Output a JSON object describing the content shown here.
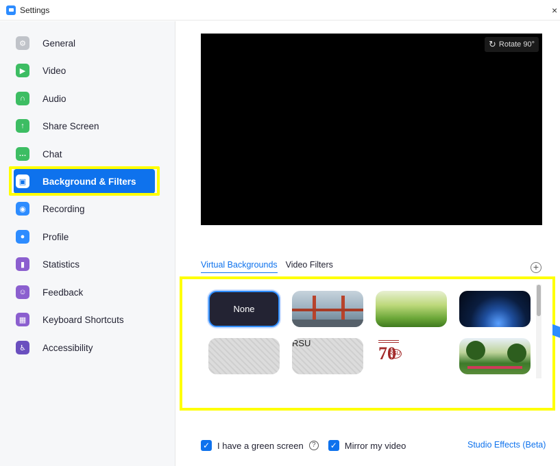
{
  "window": {
    "title": "Settings",
    "close_glyph": "×"
  },
  "sidebar": {
    "items": [
      {
        "label": "General",
        "icon": "gear-icon",
        "color": "#c0c3c9",
        "glyph": "⚙"
      },
      {
        "label": "Video",
        "icon": "video-icon",
        "color": "#3dbd63",
        "glyph": "▶"
      },
      {
        "label": "Audio",
        "icon": "headphones-icon",
        "color": "#3dbd63",
        "glyph": "∩"
      },
      {
        "label": "Share Screen",
        "icon": "share-screen-icon",
        "color": "#3dbd63",
        "glyph": "↑"
      },
      {
        "label": "Chat",
        "icon": "chat-icon",
        "color": "#3dbd63",
        "glyph": "…"
      },
      {
        "label": "Background & Filters",
        "icon": "background-icon",
        "color": "#0e72ed",
        "glyph": "▣",
        "active": true
      },
      {
        "label": "Recording",
        "icon": "recording-icon",
        "color": "#2d8cff",
        "glyph": "◉"
      },
      {
        "label": "Profile",
        "icon": "profile-icon",
        "color": "#2d8cff",
        "glyph": "●"
      },
      {
        "label": "Statistics",
        "icon": "statistics-icon",
        "color": "#8b5fcf",
        "glyph": "▮"
      },
      {
        "label": "Feedback",
        "icon": "feedback-icon",
        "color": "#8b5fcf",
        "glyph": "☺"
      },
      {
        "label": "Keyboard Shortcuts",
        "icon": "keyboard-icon",
        "color": "#8b5fcf",
        "glyph": "▦"
      },
      {
        "label": "Accessibility",
        "icon": "accessibility-icon",
        "color": "#6a4fbf",
        "glyph": "♿"
      }
    ]
  },
  "preview": {
    "rotate_label": "Rotate 90°",
    "rotate_glyph": "↻"
  },
  "tabs": [
    {
      "label": "Virtual Backgrounds",
      "active": true
    },
    {
      "label": "Video Filters",
      "active": false
    }
  ],
  "add_glyph": "+",
  "backgrounds": {
    "none_label": "None",
    "rsu_text": "RSU",
    "logo_number": "70",
    "logo_badge": "RSU"
  },
  "footer": {
    "green_screen_label": "I have a green screen",
    "green_screen_checked": true,
    "mirror_label": "Mirror my video",
    "mirror_checked": true,
    "check_glyph": "✓",
    "help_glyph": "?",
    "studio_effects_label": "Studio Effects (Beta)"
  },
  "colors": {
    "accent": "#0e72ed",
    "highlight": "#ffff00"
  }
}
